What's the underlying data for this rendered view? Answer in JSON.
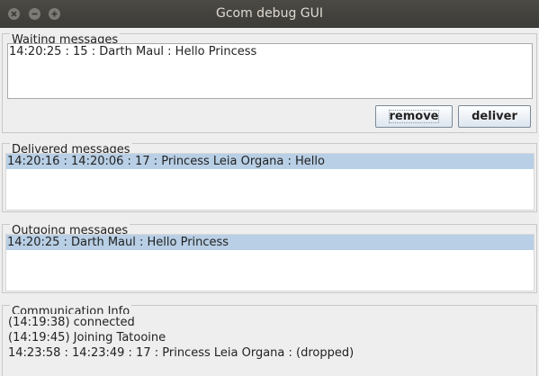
{
  "window": {
    "title": "Gcom debug GUI"
  },
  "waiting": {
    "title": "Waiting messages",
    "items": [
      "14:20:25 : 15 : Darth Maul : Hello Princess"
    ],
    "remove_label": "remove",
    "deliver_label": "deliver"
  },
  "delivered": {
    "title": "Delivered messages",
    "items": [
      "14:20:16 : 14:20:06 : 17 : Princess Leia Organa : Hello"
    ]
  },
  "outgoing": {
    "title": "Outgoing messages",
    "items": [
      "14:20:25 : Darth Maul : Hello Princess"
    ]
  },
  "info": {
    "title": "Communication Info",
    "lines": [
      "(14:19:38) connected",
      "(14:19:45) Joining Tatooine",
      "14:23:58 : 14:23:49 : 17 : Princess Leia Organa : (dropped)"
    ]
  }
}
